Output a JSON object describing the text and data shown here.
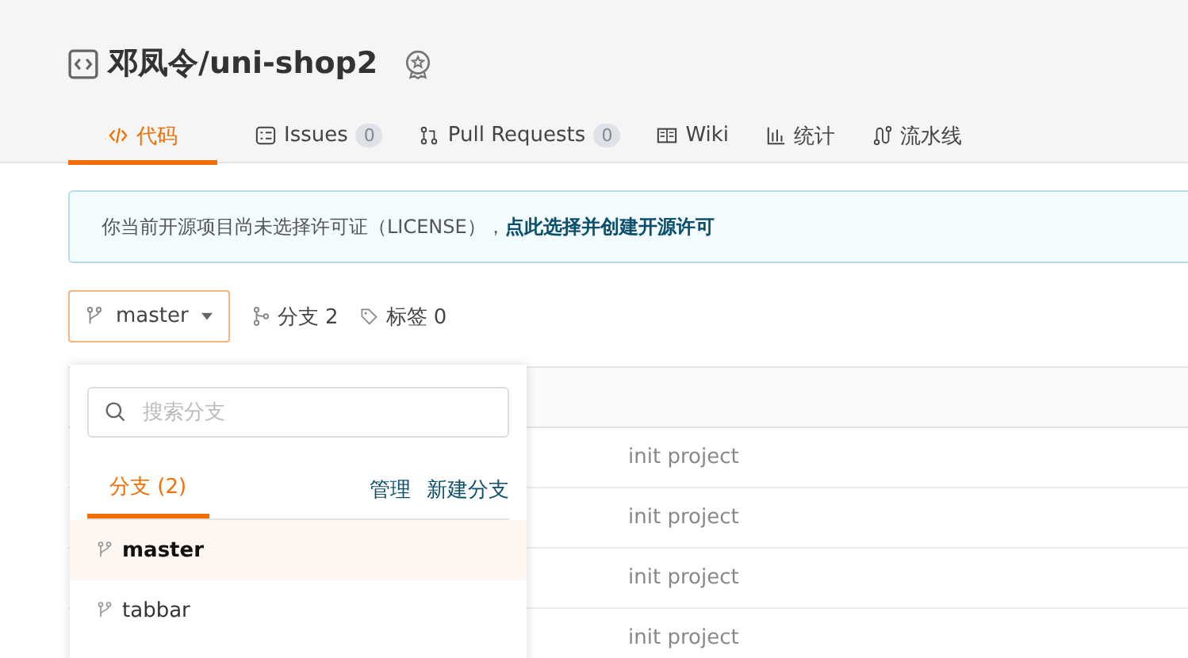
{
  "repo": {
    "title": "邓凤令/uni-shop2"
  },
  "tabs": [
    {
      "label": "代码",
      "kind": "code",
      "selected": true
    },
    {
      "label": "Issues",
      "kind": "issues",
      "count": "0",
      "selected": false
    },
    {
      "label": "Pull Requests",
      "kind": "pr",
      "count": "0",
      "selected": false
    },
    {
      "label": "Wiki",
      "kind": "wiki",
      "selected": false
    },
    {
      "label": "统计",
      "kind": "stats",
      "selected": false
    },
    {
      "label": "流水线",
      "kind": "pipeline",
      "selected": false
    }
  ],
  "notice": {
    "text": "你当前开源项目尚未选择许可证（LICENSE），",
    "link": "点此选择并创建开源许可"
  },
  "branch_bar": {
    "current": "master",
    "branches": "分支 2",
    "tags": "标签 0"
  },
  "commits": [
    {
      "message": "init project"
    },
    {
      "message": "init project"
    },
    {
      "message": "init project"
    },
    {
      "message": "init project"
    }
  ],
  "dropdown": {
    "search": {
      "placeholder": "搜索分支"
    },
    "tab": "分支 (2)",
    "actions": [
      "管理",
      "新建分支"
    ],
    "branches": [
      {
        "name": "master",
        "selected": true
      },
      {
        "name": "tabbar",
        "selected": false
      }
    ]
  }
}
